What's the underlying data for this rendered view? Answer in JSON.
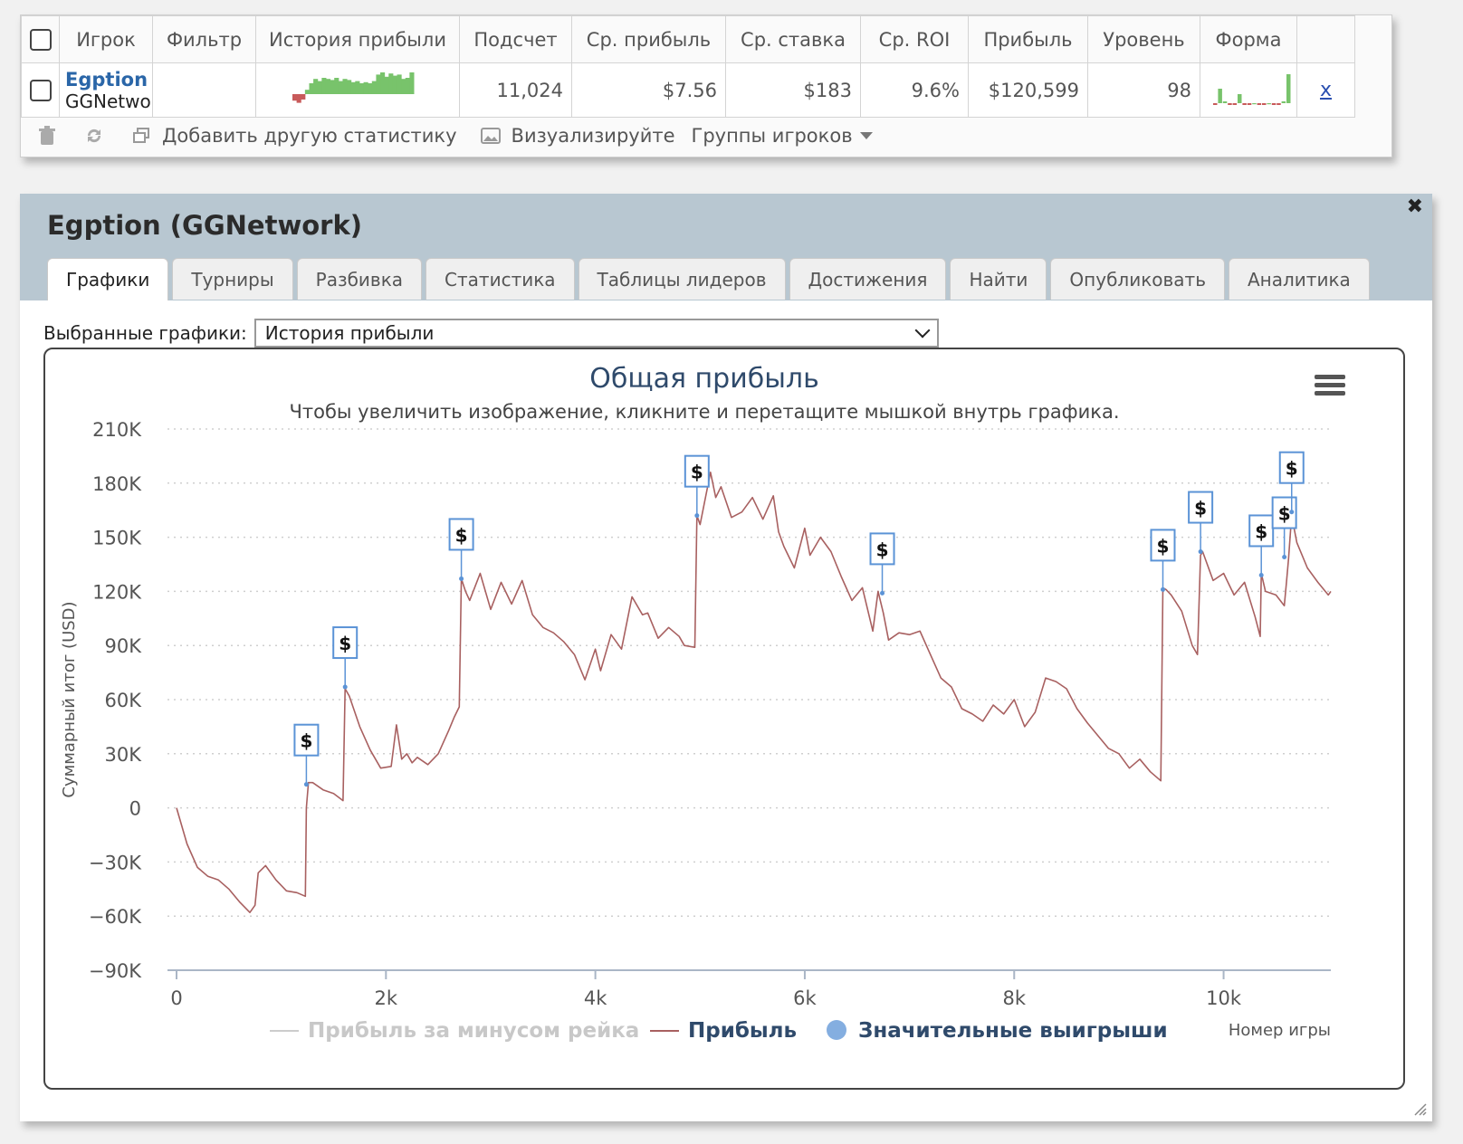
{
  "stats_table": {
    "headers": [
      "Игрок",
      "Фильтр",
      "История прибыли",
      "Подсчет",
      "Ср. прибыль",
      "Ср. ставка",
      "Ср. ROI",
      "Прибыль",
      "Уровень",
      "Форма"
    ],
    "row": {
      "player_name": "Egption",
      "network": "GGNetwork",
      "filter": "",
      "count": "11,024",
      "avg_profit": "$7.56",
      "avg_stake": "$183",
      "avg_roi": "9.6%",
      "profit": "$120,599",
      "level": "98",
      "remove_label": "x"
    },
    "toolbar": {
      "add_stats_label": "Добавить другую статистику",
      "visualize_label": "Визуализируйте",
      "groups_label": "Группы игроков"
    }
  },
  "panel": {
    "title": "Egption (GGNetwork)",
    "tabs": [
      "Графики",
      "Турниры",
      "Разбивка",
      "Статистика",
      "Таблицы лидеров",
      "Достижения",
      "Найти",
      "Опубликовать",
      "Аналитика"
    ],
    "active_tab": 0,
    "selected_charts_label": "Выбранные графики:",
    "selected_chart_value": "История прибыли"
  },
  "colors": {
    "profit_line": "#a86060",
    "big_win_marker": "#5b93d6",
    "sparkline_green": "#78c36b",
    "sparkline_red": "#c85a5a",
    "link_blue": "#2a66a8"
  },
  "chart_data": {
    "type": "line",
    "title": "Общая прибыль",
    "subtitle": "Чтобы увеличить изображение, кликните и перетащите мышкой внутрь графика.",
    "xlabel": "Номер игры",
    "ylabel": "Суммарный итог (USD)",
    "xlim": [
      0,
      11024
    ],
    "ylim": [
      -90000,
      210000
    ],
    "x_ticks": [
      0,
      2000,
      4000,
      6000,
      8000,
      10000
    ],
    "x_tick_labels": [
      "0",
      "2k",
      "4k",
      "6k",
      "8k",
      "10k"
    ],
    "y_ticks": [
      -90000,
      -60000,
      -30000,
      0,
      30000,
      60000,
      90000,
      120000,
      150000,
      180000,
      210000
    ],
    "y_tick_labels": [
      "−90K",
      "−60K",
      "−30K",
      "0",
      "30K",
      "60K",
      "90K",
      "120K",
      "150K",
      "180K",
      "210K"
    ],
    "grid": true,
    "legend_position": "bottom",
    "legend": [
      "Прибыль за минусом рейка",
      "Прибыль",
      "Значительные выигрыши"
    ],
    "series": [
      {
        "name": "Прибыль",
        "x": [
          0,
          100,
          200,
          300,
          400,
          500,
          600,
          700,
          750,
          780,
          850,
          950,
          1050,
          1150,
          1230,
          1240,
          1260,
          1300,
          1400,
          1500,
          1590,
          1610,
          1650,
          1750,
          1850,
          1950,
          2050,
          2100,
          2150,
          2200,
          2250,
          2300,
          2400,
          2500,
          2600,
          2650,
          2700,
          2720,
          2760,
          2800,
          2900,
          3000,
          3100,
          3200,
          3300,
          3400,
          3500,
          3600,
          3700,
          3800,
          3900,
          4000,
          4050,
          4150,
          4250,
          4350,
          4450,
          4500,
          4600,
          4700,
          4800,
          4850,
          4950,
          4970,
          5000,
          5100,
          5150,
          5200,
          5300,
          5400,
          5500,
          5600,
          5700,
          5750,
          5800,
          5900,
          6000,
          6050,
          6150,
          6250,
          6350,
          6450,
          6550,
          6650,
          6700,
          6750,
          6800,
          6900,
          7000,
          7100,
          7200,
          7300,
          7400,
          7500,
          7600,
          7700,
          7800,
          7900,
          8000,
          8100,
          8200,
          8300,
          8400,
          8500,
          8600,
          8700,
          8800,
          8900,
          9000,
          9100,
          9200,
          9300,
          9400,
          9420,
          9450,
          9500,
          9600,
          9700,
          9750,
          9780,
          9800,
          9900,
          10000,
          10100,
          10200,
          10300,
          10350,
          10360,
          10400,
          10500,
          10580,
          10600,
          10620,
          10650,
          10700,
          10800,
          10900,
          11000,
          11024
        ],
        "y": [
          0,
          -20000,
          -33000,
          -38000,
          -40000,
          -45000,
          -52000,
          -58000,
          -54000,
          -36000,
          -32000,
          -40000,
          -46000,
          -47000,
          -49000,
          0,
          14000,
          14000,
          10000,
          8000,
          4000,
          66000,
          62000,
          45000,
          32000,
          22000,
          23000,
          46000,
          27000,
          30000,
          25000,
          28000,
          24000,
          30000,
          43000,
          50000,
          56000,
          127000,
          120000,
          115000,
          130000,
          110000,
          125000,
          113000,
          126000,
          107000,
          100000,
          97000,
          92000,
          85000,
          71000,
          88000,
          76000,
          96000,
          88000,
          117000,
          107000,
          108000,
          94000,
          100000,
          95000,
          90000,
          89000,
          162000,
          157000,
          186000,
          172000,
          178000,
          161000,
          164000,
          172000,
          160000,
          173000,
          153000,
          145000,
          133000,
          155000,
          140000,
          150000,
          142000,
          128000,
          115000,
          122000,
          98000,
          120000,
          108000,
          93000,
          97000,
          96000,
          98000,
          85000,
          72000,
          67000,
          55000,
          52000,
          48000,
          57000,
          52000,
          60000,
          45000,
          53000,
          72000,
          70000,
          66000,
          55000,
          47000,
          40000,
          33000,
          30000,
          22000,
          27000,
          20000,
          15000,
          122000,
          121000,
          118000,
          109000,
          90000,
          85000,
          140000,
          142000,
          126000,
          130000,
          118000,
          125000,
          106000,
          95000,
          130000,
          120000,
          118000,
          112000,
          125000,
          138000,
          162000,
          147000,
          133000,
          125000,
          118000,
          120000
        ]
      },
      {
        "name": "Значительные выигрыши",
        "x": [
          1240,
          1610,
          2720,
          4970,
          6740,
          9420,
          9780,
          10360,
          10580,
          10650
        ],
        "y": [
          13000,
          67000,
          127000,
          162000,
          119000,
          121000,
          142000,
          129000,
          139000,
          164000
        ],
        "flag_label": "$"
      }
    ]
  },
  "sparkline_profit": {
    "values": [
      -6,
      -8,
      -5,
      4,
      10,
      14,
      12,
      15,
      14,
      13,
      15,
      12,
      14,
      13,
      11,
      12,
      10,
      11,
      10,
      12,
      18,
      20,
      16,
      19,
      17,
      18,
      14,
      15,
      20
    ]
  },
  "sparkline_form": {
    "values": [
      -1,
      8,
      1,
      -1,
      -1,
      5,
      -1,
      -1,
      0,
      -1,
      -1,
      0,
      -1,
      -1,
      1,
      16
    ]
  }
}
